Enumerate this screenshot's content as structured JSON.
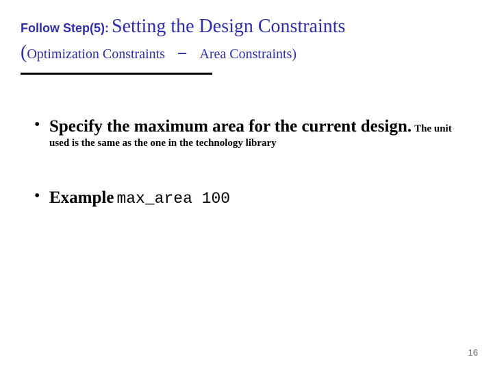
{
  "title": {
    "prefix": "Follow Step(5):",
    "main": "Setting the Design Constraints",
    "paren_open": "(",
    "sub1": "Optimization Constraints",
    "dash": " – ",
    "sub2": "Area Constraints)"
  },
  "bullets": {
    "b1_main": "Specify the maximum area for the current design.",
    "b1_tail": "The unit used is the same as the one in the technology library",
    "b2_label": "Example",
    "b2_code": "max_area 100"
  },
  "page_number": "16"
}
